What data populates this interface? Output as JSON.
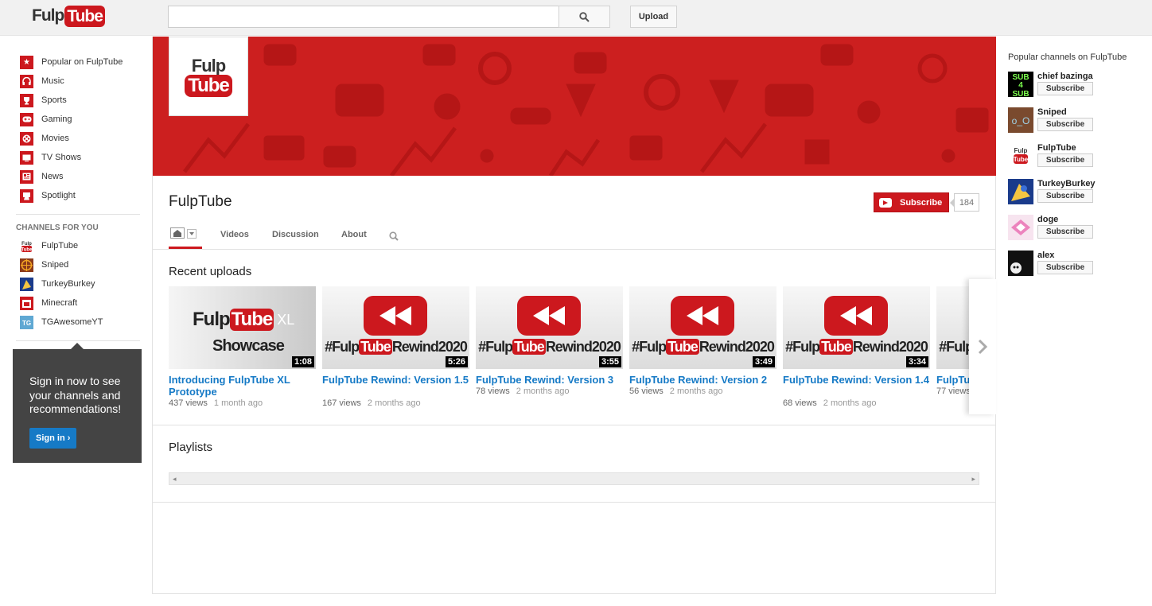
{
  "header": {
    "logo_text_a": "Fulp",
    "logo_text_b": "Tube",
    "search_placeholder": "",
    "upload_label": "Upload"
  },
  "left_nav": {
    "items": [
      {
        "label": "Popular on FulpTube",
        "icon": "star-icon"
      },
      {
        "label": "Music",
        "icon": "headphones-icon"
      },
      {
        "label": "Sports",
        "icon": "trophy-icon"
      },
      {
        "label": "Gaming",
        "icon": "gamepad-icon"
      },
      {
        "label": "Movies",
        "icon": "film-icon"
      },
      {
        "label": "TV Shows",
        "icon": "tv-icon"
      },
      {
        "label": "News",
        "icon": "newspaper-icon"
      },
      {
        "label": "Spotlight",
        "icon": "spotlight-icon"
      }
    ],
    "channels_heading": "CHANNELS FOR YOU",
    "channels": [
      {
        "label": "FulpTube",
        "color": "#cc181e"
      },
      {
        "label": "Sniped",
        "color": "#8b3a1a"
      },
      {
        "label": "TurkeyBurkey",
        "color": "#1a3b8b"
      },
      {
        "label": "Minecraft",
        "color": "#cc181e"
      },
      {
        "label": "TGAwesomeYT",
        "color": "#5fa8d3"
      }
    ]
  },
  "signin_promo": {
    "text": "Sign in now to see your channels and recommendations!",
    "button": "Sign in ›"
  },
  "channel": {
    "avatar_a": "Fulp",
    "avatar_b": "Tube",
    "name": "FulpTube",
    "subscribe_label": "Subscribe",
    "subscriber_count": "184",
    "tabs": [
      "Videos",
      "Discussion",
      "About"
    ]
  },
  "recent_uploads": {
    "title": "Recent uploads",
    "videos": [
      {
        "title": "Introducing FulpTube XL Prototype",
        "views": "437 views",
        "ago": "1 month ago",
        "duration": "1:08",
        "thumb": "showcase"
      },
      {
        "title": "FulpTube Rewind: Version 1.5",
        "views": "167 views",
        "ago": "2 months ago",
        "duration": "5:26",
        "thumb": "rewind"
      },
      {
        "title": "FulpTube Rewind: Version 3",
        "views": "78 views",
        "ago": "2 months ago",
        "duration": "3:55",
        "thumb": "rewind"
      },
      {
        "title": "FulpTube Rewind: Version 2",
        "views": "56 views",
        "ago": "2 months ago",
        "duration": "3:49",
        "thumb": "rewind"
      },
      {
        "title": "FulpTube Rewind: Version 1.4",
        "views": "68 views",
        "ago": "2 months ago",
        "duration": "3:34",
        "thumb": "rewind"
      },
      {
        "title": "FulpTu",
        "views": "77 views",
        "ago": "",
        "duration": "",
        "thumb": "rewind"
      }
    ],
    "thumb_text": {
      "showcase_a": "Fulp",
      "showcase_b": "Tube",
      "showcase_c": "XL",
      "showcase_d": "Showcase",
      "rewind_a": "#Fulp",
      "rewind_b": "Tube",
      "rewind_c": "Rewind2020"
    }
  },
  "playlists": {
    "title": "Playlists"
  },
  "popular_channels": {
    "title": "Popular channels on FulpTube",
    "subscribe_label": "Subscribe",
    "items": [
      {
        "name": "chief bazinga",
        "avatar_text": "SUB 4 SUB"
      },
      {
        "name": "Sniped",
        "avatar_text": "o_O"
      },
      {
        "name": "FulpTube",
        "avatar_text": "Fulp Tube"
      },
      {
        "name": "TurkeyBurkey",
        "avatar_text": ""
      },
      {
        "name": "doge",
        "avatar_text": ""
      },
      {
        "name": "alex",
        "avatar_text": ""
      }
    ]
  },
  "colors": {
    "brand_red": "#cc181e",
    "link_blue": "#167ac6",
    "banner_red": "#cc1f1f"
  }
}
